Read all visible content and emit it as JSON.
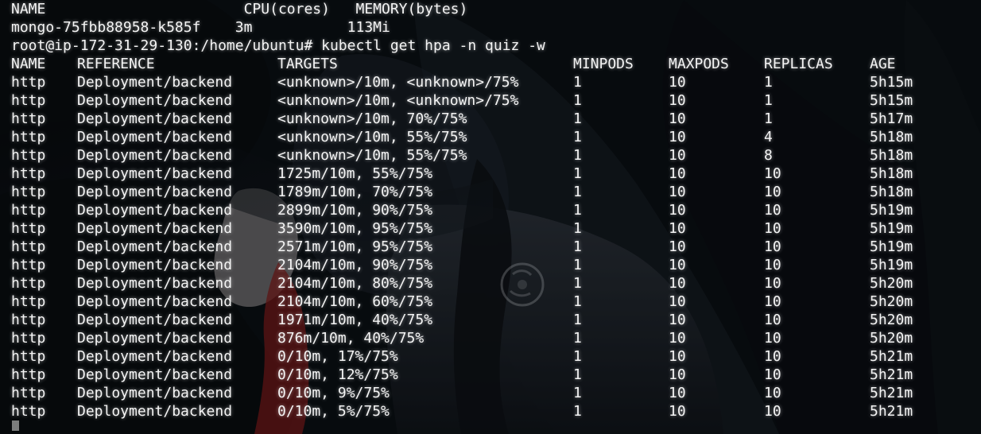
{
  "terminal": {
    "top_lines": [
      "NAME                       CPU(cores)   MEMORY(bytes)",
      "mongo-75fbb88958-k585f    3m           113Mi",
      "root@ip-172-31-29-130:/home/ubuntu# kubectl get hpa -n quiz -w"
    ],
    "hpa": {
      "headers": {
        "name": "NAME",
        "reference": "REFERENCE",
        "targets": "TARGETS",
        "minpods": "MINPODS",
        "maxpods": "MAXPODS",
        "replicas": "REPLICAS",
        "age": "AGE"
      },
      "rows": [
        {
          "name": "http",
          "reference": "Deployment/backend",
          "targets": "<unknown>/10m, <unknown>/75%",
          "minpods": "1",
          "maxpods": "10",
          "replicas": "1",
          "age": "5h15m"
        },
        {
          "name": "http",
          "reference": "Deployment/backend",
          "targets": "<unknown>/10m, <unknown>/75%",
          "minpods": "1",
          "maxpods": "10",
          "replicas": "1",
          "age": "5h15m"
        },
        {
          "name": "http",
          "reference": "Deployment/backend",
          "targets": "<unknown>/10m, 70%/75%",
          "minpods": "1",
          "maxpods": "10",
          "replicas": "1",
          "age": "5h17m"
        },
        {
          "name": "http",
          "reference": "Deployment/backend",
          "targets": "<unknown>/10m, 55%/75%",
          "minpods": "1",
          "maxpods": "10",
          "replicas": "4",
          "age": "5h18m"
        },
        {
          "name": "http",
          "reference": "Deployment/backend",
          "targets": "<unknown>/10m, 55%/75%",
          "minpods": "1",
          "maxpods": "10",
          "replicas": "8",
          "age": "5h18m"
        },
        {
          "name": "http",
          "reference": "Deployment/backend",
          "targets": "1725m/10m, 55%/75%",
          "minpods": "1",
          "maxpods": "10",
          "replicas": "10",
          "age": "5h18m"
        },
        {
          "name": "http",
          "reference": "Deployment/backend",
          "targets": "1789m/10m, 70%/75%",
          "minpods": "1",
          "maxpods": "10",
          "replicas": "10",
          "age": "5h18m"
        },
        {
          "name": "http",
          "reference": "Deployment/backend",
          "targets": "2899m/10m, 90%/75%",
          "minpods": "1",
          "maxpods": "10",
          "replicas": "10",
          "age": "5h19m"
        },
        {
          "name": "http",
          "reference": "Deployment/backend",
          "targets": "3590m/10m, 95%/75%",
          "minpods": "1",
          "maxpods": "10",
          "replicas": "10",
          "age": "5h19m"
        },
        {
          "name": "http",
          "reference": "Deployment/backend",
          "targets": "2571m/10m, 95%/75%",
          "minpods": "1",
          "maxpods": "10",
          "replicas": "10",
          "age": "5h19m"
        },
        {
          "name": "http",
          "reference": "Deployment/backend",
          "targets": "2104m/10m, 90%/75%",
          "minpods": "1",
          "maxpods": "10",
          "replicas": "10",
          "age": "5h19m"
        },
        {
          "name": "http",
          "reference": "Deployment/backend",
          "targets": "2104m/10m, 80%/75%",
          "minpods": "1",
          "maxpods": "10",
          "replicas": "10",
          "age": "5h20m"
        },
        {
          "name": "http",
          "reference": "Deployment/backend",
          "targets": "2104m/10m, 60%/75%",
          "minpods": "1",
          "maxpods": "10",
          "replicas": "10",
          "age": "5h20m"
        },
        {
          "name": "http",
          "reference": "Deployment/backend",
          "targets": "1971m/10m, 40%/75%",
          "minpods": "1",
          "maxpods": "10",
          "replicas": "10",
          "age": "5h20m"
        },
        {
          "name": "http",
          "reference": "Deployment/backend",
          "targets": "876m/10m, 40%/75%",
          "minpods": "1",
          "maxpods": "10",
          "replicas": "10",
          "age": "5h20m"
        },
        {
          "name": "http",
          "reference": "Deployment/backend",
          "targets": "0/10m, 17%/75%",
          "minpods": "1",
          "maxpods": "10",
          "replicas": "10",
          "age": "5h21m"
        },
        {
          "name": "http",
          "reference": "Deployment/backend",
          "targets": "0/10m, 12%/75%",
          "minpods": "1",
          "maxpods": "10",
          "replicas": "10",
          "age": "5h21m"
        },
        {
          "name": "http",
          "reference": "Deployment/backend",
          "targets": "0/10m, 9%/75%",
          "minpods": "1",
          "maxpods": "10",
          "replicas": "10",
          "age": "5h21m"
        },
        {
          "name": "http",
          "reference": "Deployment/backend",
          "targets": "0/10m, 5%/75%",
          "minpods": "1",
          "maxpods": "10",
          "replicas": "10",
          "age": "5h21m"
        }
      ]
    }
  },
  "colors": {
    "text": "#f4f4f4",
    "background": "#111820",
    "cursor": "#dcdcdc"
  }
}
